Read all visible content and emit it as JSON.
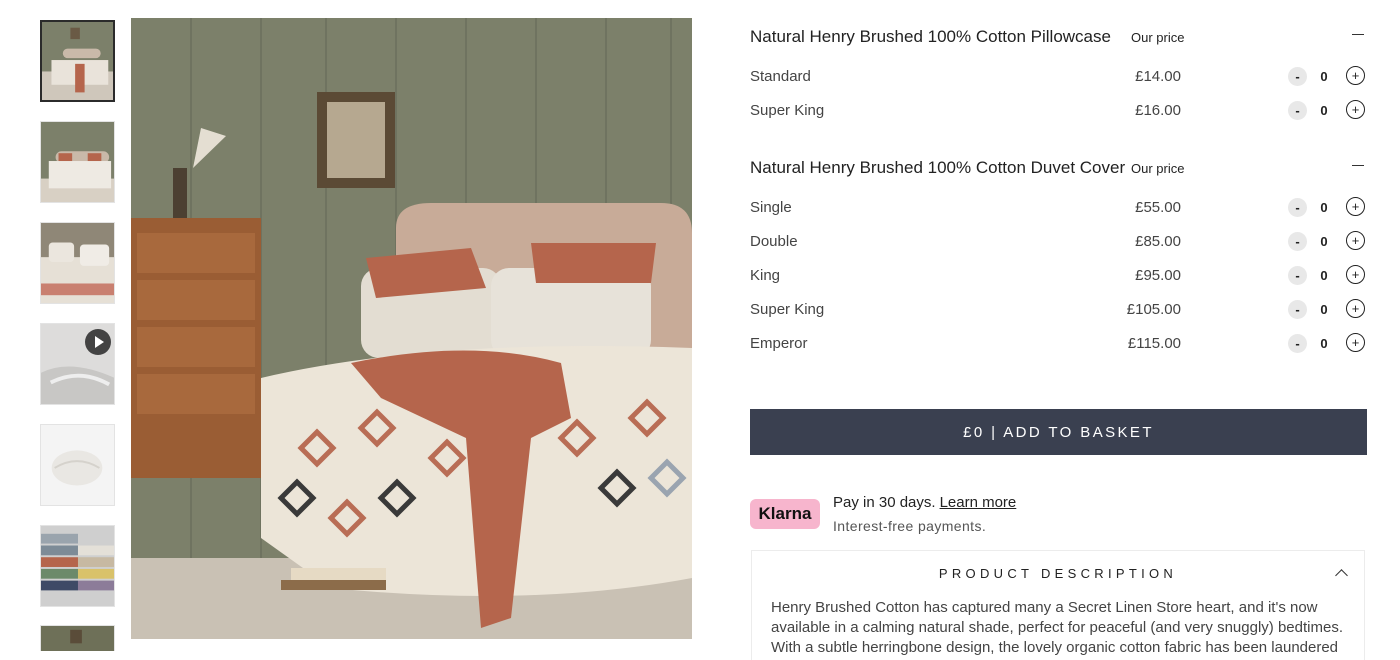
{
  "pillowcase": {
    "title": "Natural Henry Brushed 100% Cotton Pillowcase",
    "price_label": "Our price",
    "rows": [
      {
        "label": "Standard",
        "price": "£14.00",
        "qty": "0"
      },
      {
        "label": "Super King",
        "price": "£16.00",
        "qty": "0"
      }
    ]
  },
  "duvet": {
    "title": "Natural Henry Brushed 100% Cotton Duvet Cover",
    "price_label": "Our price",
    "rows": [
      {
        "label": "Single",
        "price": "£55.00",
        "qty": "0"
      },
      {
        "label": "Double",
        "price": "£85.00",
        "qty": "0"
      },
      {
        "label": "King",
        "price": "£95.00",
        "qty": "0"
      },
      {
        "label": "Super King",
        "price": "£105.00",
        "qty": "0"
      },
      {
        "label": "Emperor",
        "price": "£115.00",
        "qty": "0"
      }
    ]
  },
  "controls": {
    "minus": "-",
    "plus": "+"
  },
  "basket": {
    "label": "£0 | ADD TO BASKET"
  },
  "klarna": {
    "logo": "Klarna",
    "line1": "Pay in 30 days.",
    "link": "Learn more",
    "line2": "Interest-free payments."
  },
  "description": {
    "title": "PRODUCT DESCRIPTION",
    "text": "Henry Brushed Cotton has captured many a Secret Linen Store heart, and it's now available in a calming natural shade, perfect for peaceful (and very snuggly) bedtimes. With a subtle herringbone design, the lovely organic cotton fabric has been laundered"
  },
  "colors": {
    "button": "#3a4050",
    "klarna": "#f7b5cd",
    "wall": "#7c806a",
    "throw": "#b5654c"
  },
  "gallery": {
    "icons": [
      "play-icon"
    ]
  }
}
